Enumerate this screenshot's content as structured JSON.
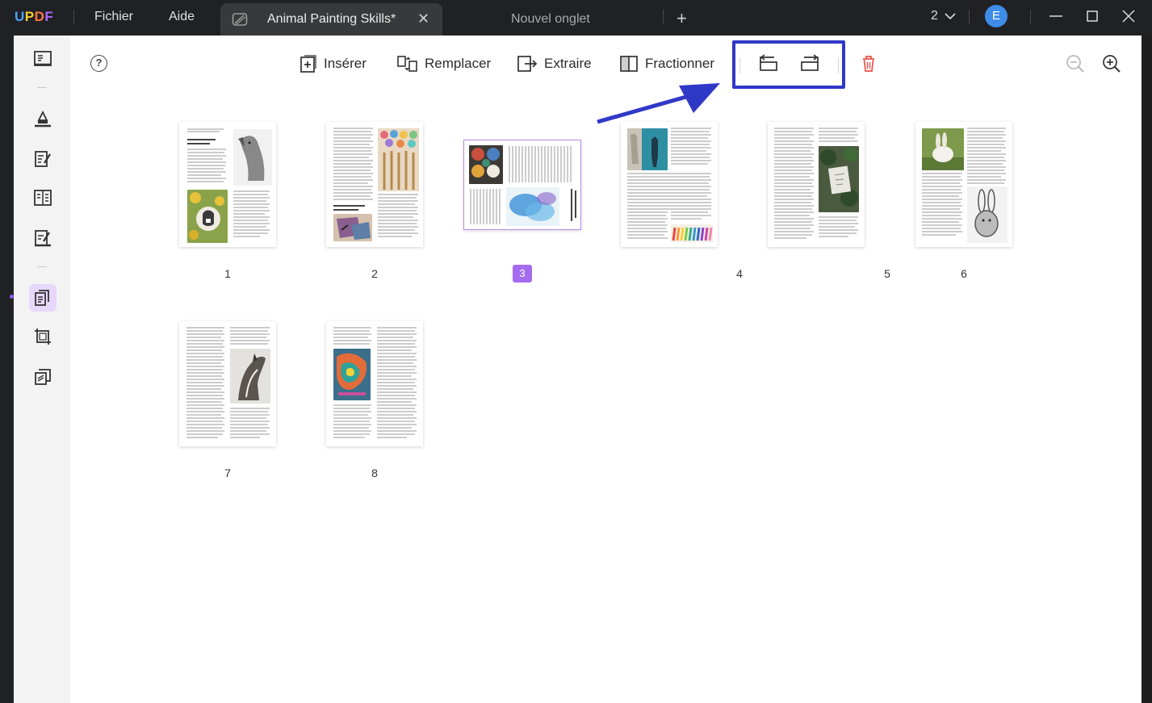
{
  "app": {
    "logo": {
      "u": "U",
      "p": "P",
      "d": "D",
      "f": "F"
    },
    "menus": [
      "Fichier",
      "Aide"
    ],
    "active_tab": "Animal Painting Skills*",
    "inactive_tab": "Nouvel onglet",
    "window_count": "2",
    "avatar_letter": "E"
  },
  "toolbar": {
    "insert": "Insérer",
    "replace": "Remplacer",
    "extract": "Extraire",
    "split": "Fractionner"
  },
  "pages": [
    {
      "number": "1"
    },
    {
      "number": "2"
    },
    {
      "number": "3",
      "selected": true
    },
    {
      "number": "4"
    },
    {
      "number": "5"
    },
    {
      "number": "6"
    },
    {
      "number": "7"
    },
    {
      "number": "8"
    }
  ],
  "colors": {
    "accent": "#a56cf0",
    "highlight": "#3038c8",
    "delete": "#e9534a"
  }
}
